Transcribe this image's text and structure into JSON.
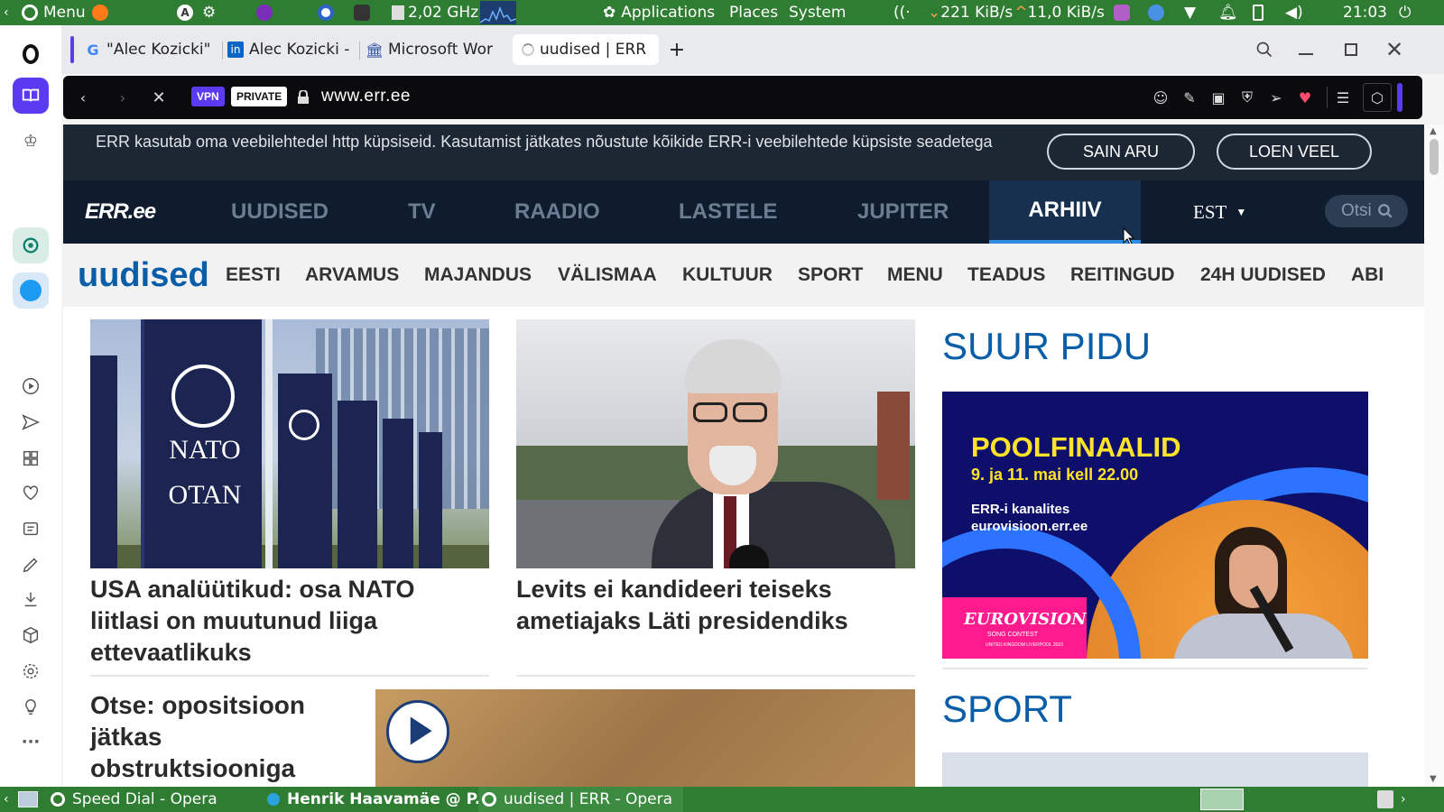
{
  "top_panel": {
    "menu_label": "Menu",
    "cpu_freq": "2,02 GHz",
    "applications_label": "Applications",
    "places_label": "Places",
    "system_label": "System",
    "net_down": "221 KiB/s",
    "net_up": "11,0 KiB/s",
    "clock": "21:03"
  },
  "tabs": [
    {
      "label": "\"Alec Kozicki\"",
      "icon": "google-icon"
    },
    {
      "label": "Alec Kozicki - F",
      "icon": "linkedin-icon"
    },
    {
      "label": "Microsoft Wor",
      "icon": "museum-icon"
    },
    {
      "label": "uudised | ERR",
      "icon": "loading-icon",
      "active": true
    }
  ],
  "address_bar": {
    "vpn_label": "VPN",
    "private_label": "PRIVATE",
    "url": "www.err.ee"
  },
  "cookie_banner": {
    "text": "ERR kasutab oma veebilehtedel http küpsiseid. Kasutamist jätkates nõustute kõikide ERR-i veebilehtede küpsiste seadetega",
    "accept_label": "SAIN ARU",
    "more_label": "LOEN VEEL"
  },
  "err_nav": {
    "logo": "ERR.ee",
    "items": [
      "UUDISED",
      "TV",
      "RAADIO",
      "LASTELE",
      "JUPITER",
      "ARHIIV"
    ],
    "active": "ARHIIV",
    "lang": "EST",
    "search_placeholder": "Otsi"
  },
  "sub_nav": {
    "section_title": "uudised",
    "items": [
      "EESTI",
      "ARVAMUS",
      "MAJANDUS",
      "VÄLISMAA",
      "KULTUUR",
      "SPORT",
      "MENU",
      "TEADUS",
      "REITINGUD",
      "24H UUDISED",
      "ABI"
    ]
  },
  "articles": [
    {
      "headline": "USA analüütikud: osa NATO liitlasi on muutunud liiga ettevaatlikuks",
      "image_flag_text_1": "NATO",
      "image_flag_text_2": "OTAN"
    },
    {
      "headline": "Levits ei kandideeri teiseks ametiajaks Läti presidendiks"
    },
    {
      "headline": "Otse: opositsioon jätkas obstruktsiooniga"
    }
  ],
  "sidebar_right": {
    "section1_title": "SUUR PIDU",
    "banner": {
      "title": "POOLFINAALID",
      "dates": "9. ja 11. mai kell 22.00",
      "channels_line1": "ERR-i kanalites",
      "channels_line2": "eurovisioon.err.ee",
      "logo_text": "EUROVISION",
      "logo_sub": "SONG CONTEST",
      "logo_city": "UNITED KINGDOM LIVERPOOL 2023"
    },
    "section2_title": "SPORT"
  },
  "taskbar": {
    "items": [
      "Speed Dial - Opera",
      "Henrik Haavamäe @ P...",
      "uudised | ERR - Opera"
    ]
  },
  "colors": {
    "panel_green": "#2f7d32",
    "err_navy": "#0f1c2e",
    "err_blue": "#0a5ea8",
    "eurovision_navy": "#0e0f6b",
    "eurovision_yellow": "#ffe32a",
    "eurovision_pink": "#ff1b8d"
  }
}
